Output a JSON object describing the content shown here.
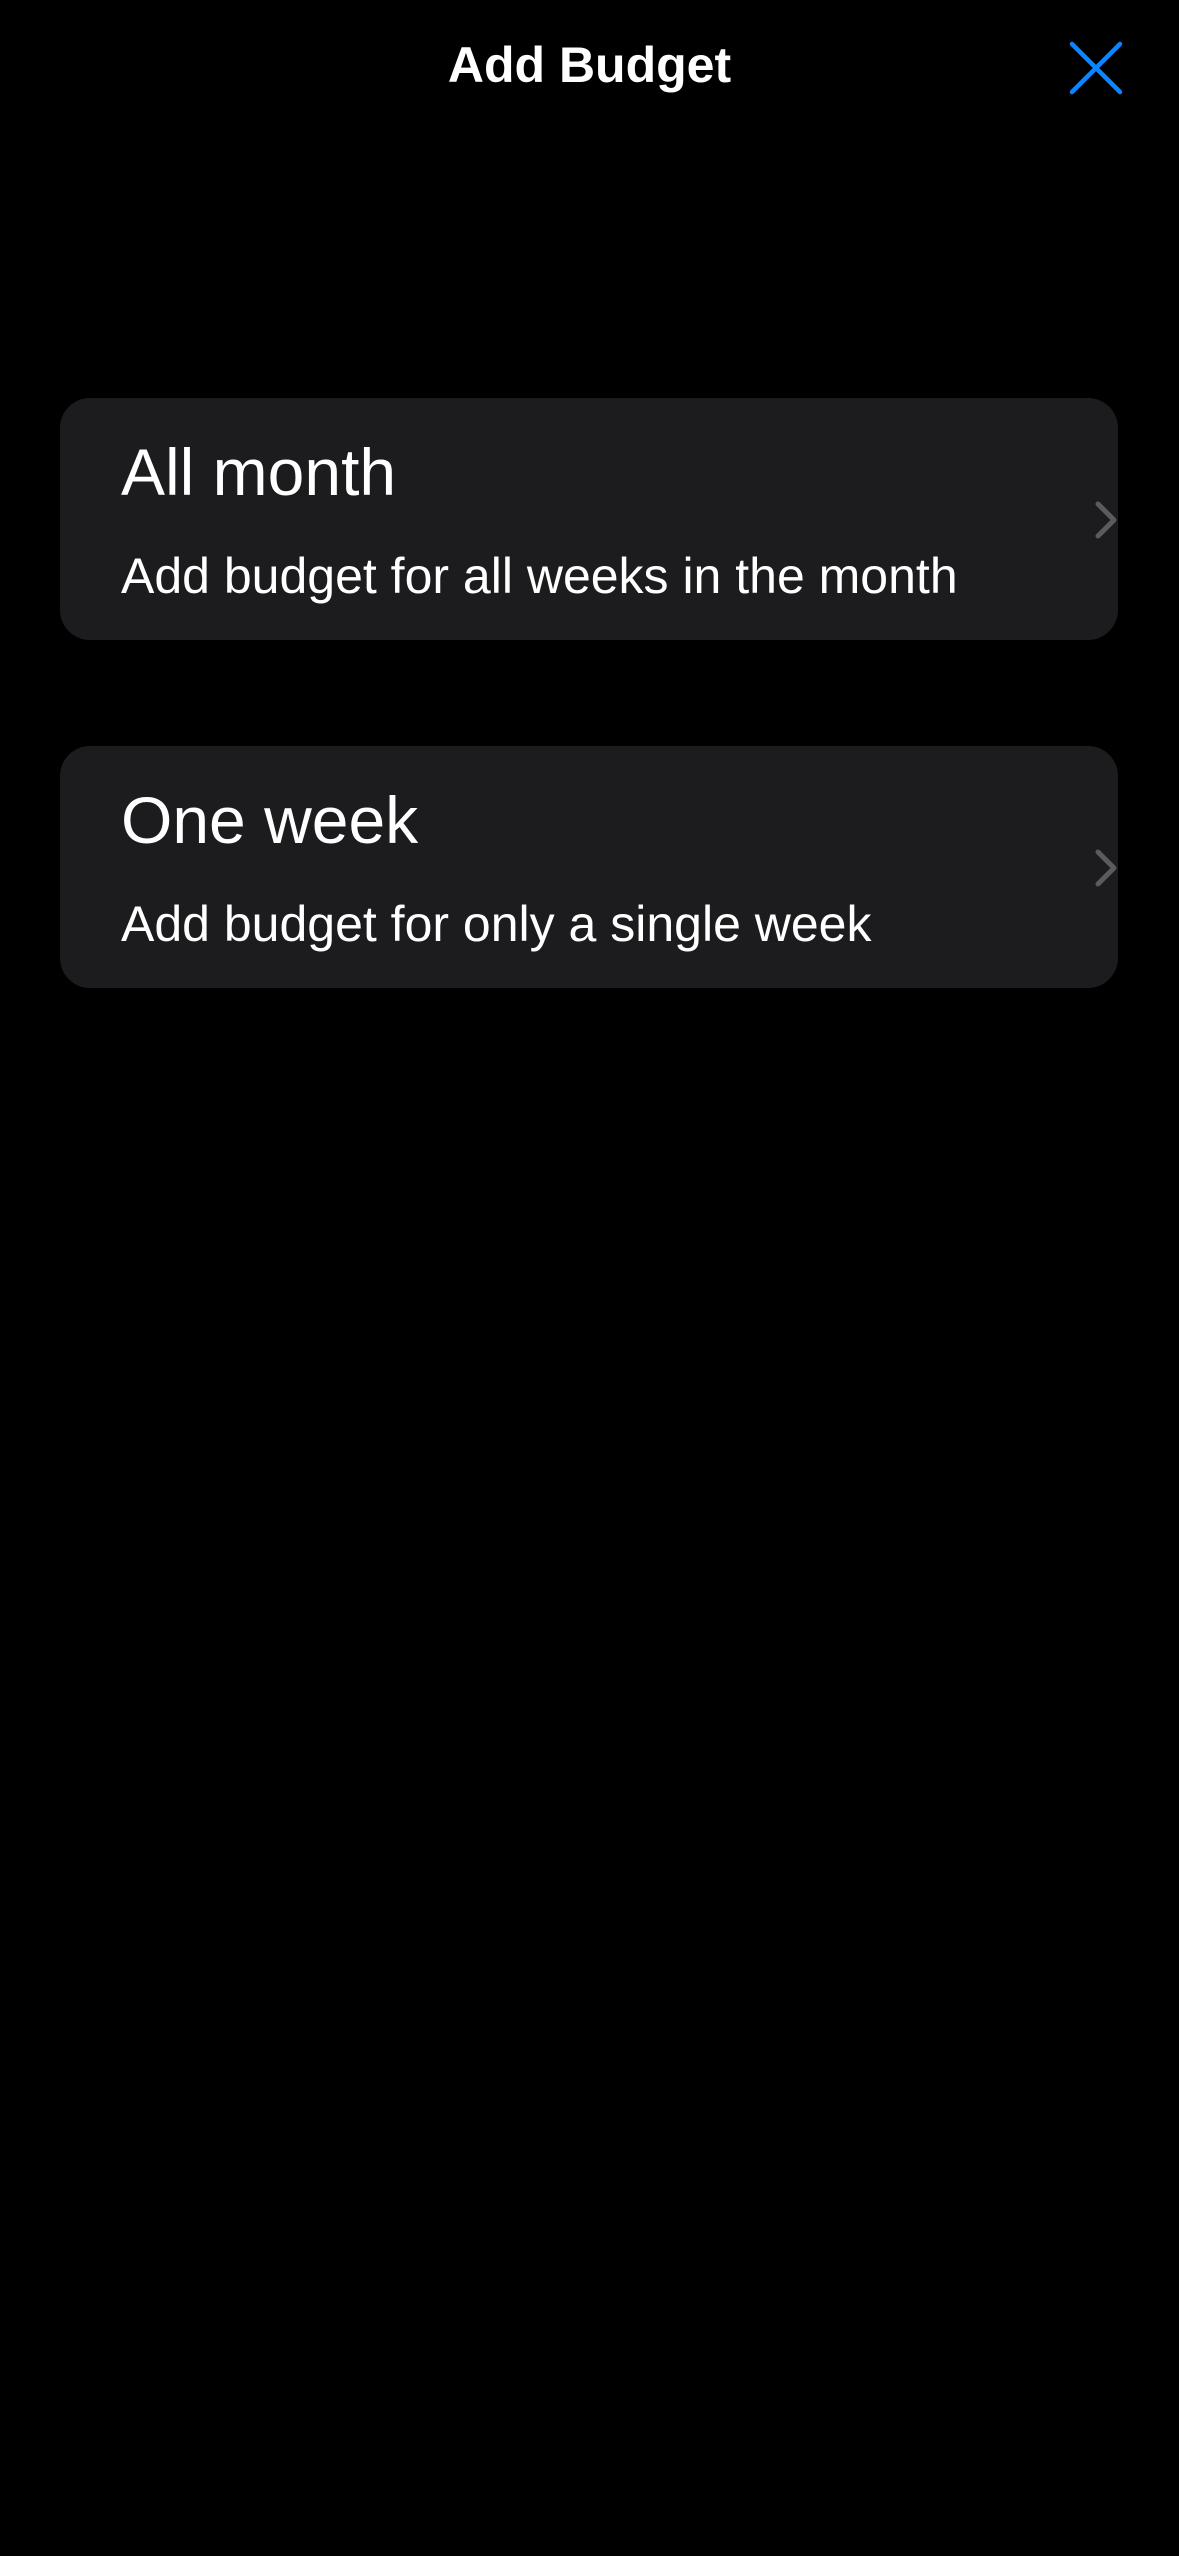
{
  "header": {
    "title": "Add Budget",
    "close_icon": "close-icon",
    "accent_color": "#0a84ff"
  },
  "options": [
    {
      "title": "All month",
      "subtitle": "Add budget for all weeks in the month",
      "icon": "chevron-right-icon"
    },
    {
      "title": "One week",
      "subtitle": "Add budget for only a single week",
      "icon": "chevron-right-icon"
    }
  ],
  "colors": {
    "background": "#000000",
    "card": "#1c1c1e",
    "text": "#ffffff",
    "chevron": "#5a5a5f"
  }
}
